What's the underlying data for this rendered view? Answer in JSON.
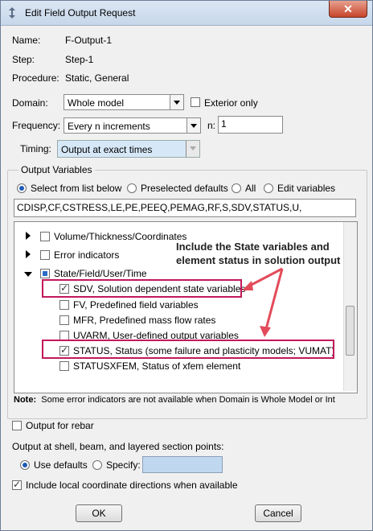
{
  "window": {
    "title": "Edit Field Output Request",
    "close_label": "✕"
  },
  "info": {
    "name_label": "Name:",
    "name_value": "F-Output-1",
    "step_label": "Step:",
    "step_value": "Step-1",
    "procedure_label": "Procedure:",
    "procedure_value": "Static, General"
  },
  "domain": {
    "label": "Domain:",
    "value": "Whole model",
    "exterior_label": "Exterior only",
    "exterior_checked": false
  },
  "frequency": {
    "label": "Frequency:",
    "value": "Every n increments",
    "n_label": "n:",
    "n_value": "1"
  },
  "timing": {
    "label": "Timing:",
    "value": "Output at exact times"
  },
  "output_variables": {
    "group_label": "Output Variables",
    "options": [
      "Select from list below",
      "Preselected defaults",
      "All",
      "Edit variables"
    ],
    "selected": "Select from list below",
    "variables_text": "CDISP,CF,CSTRESS,LE,PE,PEEQ,PEMAG,RF,S,SDV,STATUS,U,"
  },
  "tree": {
    "items": [
      {
        "label": "Volume/Thickness/Coordinates",
        "checked": false
      },
      {
        "label": "Error indicators",
        "checked": false
      },
      {
        "label": "State/Field/User/Time",
        "checked": "partial"
      },
      {
        "label": "SDV, Solution dependent state variables",
        "checked": true
      },
      {
        "label": "FV, Predefined field variables",
        "checked": false
      },
      {
        "label": "MFR, Predefined mass flow rates",
        "checked": false
      },
      {
        "label": "UVARM, User-defined output variables",
        "checked": false
      },
      {
        "label": "STATUS, Status (some failure and plasticity models; VUMAT)",
        "checked": true
      },
      {
        "label": "STATUSXFEM, Status of xfem element",
        "checked": false
      }
    ]
  },
  "annotation": {
    "line1": "Include the State variables and",
    "line2": "element status in solution output",
    "color": "#e34b5a"
  },
  "note": {
    "label": "Note:",
    "text": "Some error indicators are not available when Domain is Whole Model or Int"
  },
  "rebar": {
    "label": "Output for rebar",
    "checked": false
  },
  "section_points": {
    "label": "Output at shell, beam, and layered section points:",
    "use_defaults": "Use defaults",
    "specify": "Specify:",
    "selected": "Use defaults"
  },
  "local_coords": {
    "label": "Include local coordinate directions when available",
    "checked": true
  },
  "buttons": {
    "ok": "OK",
    "cancel": "Cancel"
  }
}
